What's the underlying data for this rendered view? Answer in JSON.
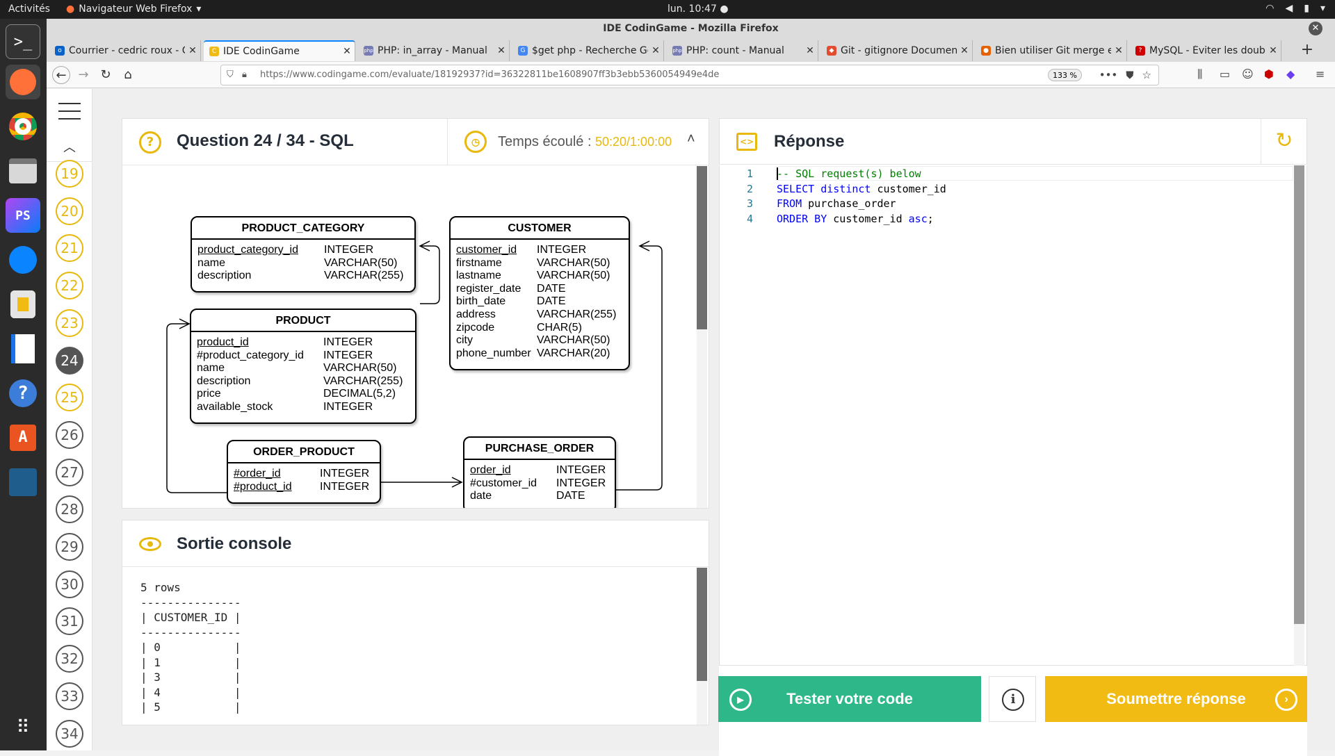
{
  "os": {
    "activities": "Activités",
    "app_name": "Navigateur Web Firefox",
    "clock": "lun. 10:47 ●"
  },
  "window": {
    "title": "IDE CodinGame - Mozilla Firefox"
  },
  "tabs": [
    {
      "label": "Courrier - cedric roux - C",
      "icon_color": "#0a62c9",
      "icon": "o"
    },
    {
      "label": "IDE CodinGame",
      "icon_color": "#f2bb13",
      "icon": "C"
    },
    {
      "label": "PHP: in_array - Manual",
      "icon_color": "#777bb3",
      "icon": "php"
    },
    {
      "label": "$get php - Recherche Go",
      "icon_color": "#4285f4",
      "icon": "G"
    },
    {
      "label": "PHP: count - Manual",
      "icon_color": "#777bb3",
      "icon": "php"
    },
    {
      "label": "Git - gitignore Document",
      "icon_color": "#e44c30",
      "icon": "◆"
    },
    {
      "label": "Bien utiliser Git merge et",
      "icon_color": "#e66000",
      "icon": "●"
    },
    {
      "label": "MySQL - Éviter les doubl",
      "icon_color": "#c00",
      "icon": "?"
    }
  ],
  "nav": {
    "url": "https://www.codingame.com/evaluate/18192937?id=36322811be1608907ff3b3ebb5360054949e4de",
    "zoom": "133 %"
  },
  "question_nav": {
    "numbers": [
      "19",
      "20",
      "21",
      "22",
      "23",
      "24",
      "25",
      "26",
      "27",
      "28",
      "29",
      "30",
      "31",
      "32",
      "33",
      "34"
    ]
  },
  "question": {
    "title": "Question 24 / 34 - SQL",
    "timer_label": "Temps écoulé : ",
    "timer_value": "50:20/1:00:00"
  },
  "diagram": {
    "tables": {
      "product_category": {
        "name": "PRODUCT_CATEGORY",
        "rows": [
          [
            "product_category_id",
            "INTEGER"
          ],
          [
            "name",
            "VARCHAR(50)"
          ],
          [
            "description",
            "VARCHAR(255)"
          ]
        ]
      },
      "customer": {
        "name": "CUSTOMER",
        "rows": [
          [
            "customer_id",
            "INTEGER"
          ],
          [
            "firstname",
            "VARCHAR(50)"
          ],
          [
            "lastname",
            "VARCHAR(50)"
          ],
          [
            "register_date",
            "DATE"
          ],
          [
            "birth_date",
            "DATE"
          ],
          [
            "address",
            "VARCHAR(255)"
          ],
          [
            "zipcode",
            "CHAR(5)"
          ],
          [
            "city",
            "VARCHAR(50)"
          ],
          [
            "phone_number",
            "VARCHAR(20)"
          ]
        ]
      },
      "product": {
        "name": "PRODUCT",
        "rows": [
          [
            "product_id",
            "INTEGER"
          ],
          [
            "#product_category_id",
            "INTEGER"
          ],
          [
            "name",
            "VARCHAR(50)"
          ],
          [
            "description",
            "VARCHAR(255)"
          ],
          [
            "price",
            "DECIMAL(5,2)"
          ],
          [
            "available_stock",
            "INTEGER"
          ]
        ]
      },
      "order_product": {
        "name": "ORDER_PRODUCT",
        "rows": [
          [
            "#order_id",
            "INTEGER"
          ],
          [
            "#product_id",
            "INTEGER"
          ]
        ]
      },
      "purchase_order": {
        "name": "PURCHASE_ORDER",
        "rows": [
          [
            "order_id",
            "INTEGER"
          ],
          [
            "#customer_id",
            "INTEGER"
          ],
          [
            "date",
            "DATE"
          ]
        ]
      }
    }
  },
  "console": {
    "title": "Sortie console",
    "lines": [
      "5 rows",
      "---------------",
      "| CUSTOMER_ID |",
      "---------------",
      "| 0           |",
      "| 1           |",
      "| 3           |",
      "| 4           |",
      "| 5           |"
    ]
  },
  "answer": {
    "title": "Réponse",
    "line_numbers": [
      "1",
      "2",
      "3",
      "4"
    ],
    "code": {
      "l1": "-- SQL request(s) below",
      "l2_kw": "SELECT distinct",
      "l2_rest": " customer_id",
      "l3_kw": "FROM",
      "l3_rest": " purchase_order",
      "l4_kw": "ORDER BY",
      "l4_mid": " customer_id ",
      "l4_kw2": "asc",
      "l4_end": ";"
    }
  },
  "buttons": {
    "test": "Tester votre code",
    "submit": "Soumettre réponse"
  },
  "colors": {
    "accent_yellow": "#e8b80c",
    "test_green": "#2eb88a",
    "submit_yellow": "#f2bb13"
  }
}
